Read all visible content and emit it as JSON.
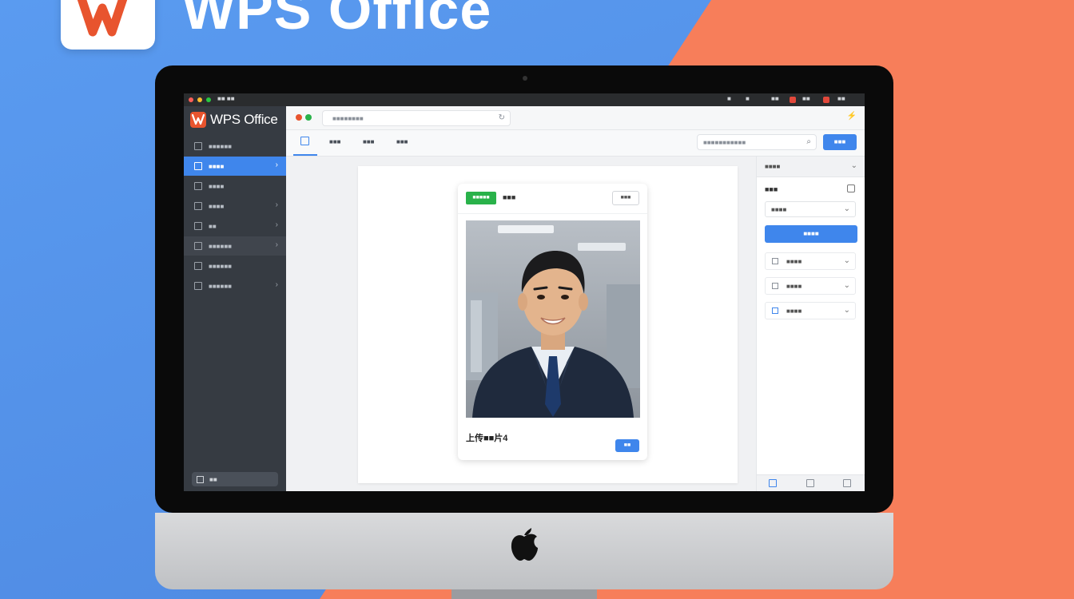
{
  "brand": {
    "title": "WPS Office"
  },
  "menubar": {
    "items": [
      "■■ ■■",
      "■",
      "■",
      "■■",
      "■■",
      "■■"
    ]
  },
  "sidebar": {
    "logo_text": "WPS Office",
    "items": [
      {
        "label": "■■■■■■",
        "icon": "grid-icon"
      },
      {
        "label": "■■■■",
        "icon": "template-icon"
      },
      {
        "label": "■■■■",
        "icon": "document-icon"
      },
      {
        "label": "■■■■",
        "icon": "chart-icon"
      },
      {
        "label": "■■",
        "icon": "table-icon"
      },
      {
        "label": "■■■■■■",
        "icon": "form-icon"
      },
      {
        "label": "■■■■■■",
        "icon": "list-icon"
      },
      {
        "label": "■■■■■■",
        "icon": "settings-icon"
      }
    ],
    "bottom_label": "■■"
  },
  "topbar": {
    "address": "■■■■■■■■",
    "refresh": "↻",
    "right_icon": "⚡"
  },
  "tabs": [
    {
      "label": "■■■"
    },
    {
      "label": "■■■"
    },
    {
      "label": "■■■"
    }
  ],
  "search": {
    "placeholder": "■■■■■■■■■■■",
    "icon": "⌕"
  },
  "toolbar": {
    "primary_label": "■■■"
  },
  "card": {
    "badge": "■■■■■",
    "title": "■■■",
    "button": "■■■",
    "upload_label": "上传■■片4",
    "ok_button": "■■"
  },
  "panel": {
    "header": "■■■■",
    "title": "■■■",
    "select_value": "■■■■",
    "primary_button": "■■■■",
    "rows": [
      {
        "label": "■■■■"
      },
      {
        "label": "■■■■"
      },
      {
        "label": "■■■■"
      }
    ]
  },
  "colors": {
    "accent": "#3f86ec",
    "brand": "#e8542e",
    "badge": "#29b24a",
    "sidebar": "#363b42"
  }
}
